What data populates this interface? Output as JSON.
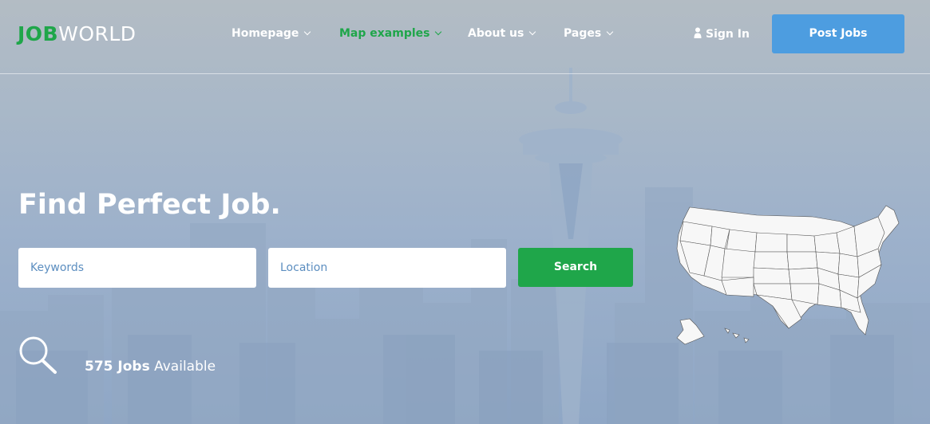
{
  "header": {
    "logo_part1": "JOB",
    "logo_part2": "WORLD",
    "nav": [
      {
        "label": "Homepage",
        "active": false
      },
      {
        "label": "Map examples",
        "active": true
      },
      {
        "label": "About us",
        "active": false
      },
      {
        "label": "Pages",
        "active": false
      }
    ],
    "signin_label": "Sign In",
    "post_jobs_label": "Post Jobs"
  },
  "hero": {
    "headline": "Find Perfect Job.",
    "keywords_placeholder": "Keywords",
    "location_placeholder": "Location",
    "search_label": "Search",
    "jobs_count": "575 Jobs",
    "jobs_suffix": "Available"
  },
  "icons": {
    "user": "user-icon",
    "chevron": "chevron-down-icon",
    "magnifier": "search-icon",
    "map": "us-map-icon"
  },
  "colors": {
    "brand_green": "#1fa64a",
    "post_blue": "#4d9de0",
    "placeholder_blue": "#5c8ec0",
    "white": "#ffffff"
  }
}
